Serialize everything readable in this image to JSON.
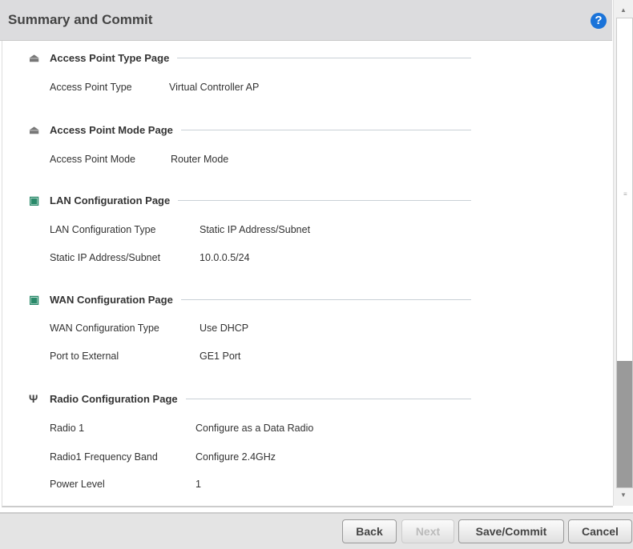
{
  "header": {
    "title": "Summary and Commit",
    "help_icon": "?"
  },
  "sections": [
    {
      "title": "Access Point Type Page",
      "icon": "access-point-icon",
      "rows": [
        {
          "k": "Access Point Type",
          "v": "Virtual Controller AP"
        }
      ]
    },
    {
      "title": "Access Point Mode Page",
      "icon": "access-point-icon",
      "rows": [
        {
          "k": "Access Point Mode",
          "v": "Router Mode"
        }
      ]
    },
    {
      "title": "LAN Configuration Page",
      "icon": "network-icon",
      "rows": [
        {
          "k": "LAN Configuration Type",
          "v": "Static IP Address/Subnet"
        },
        {
          "k": "Static IP Address/Subnet",
          "v": "10.0.0.5/24"
        }
      ]
    },
    {
      "title": "WAN Configuration Page",
      "icon": "network-icon",
      "rows": [
        {
          "k": "WAN Configuration Type",
          "v": "Use DHCP"
        },
        {
          "k": "Port to External",
          "v": "GE1 Port"
        }
      ]
    },
    {
      "title": "Radio Configuration Page",
      "icon": "antenna-icon",
      "rows": [
        {
          "k": "Radio 1",
          "v": "Configure as a Data Radio"
        },
        {
          "k": "Radio1 Frequency Band",
          "v": "Configure 2.4GHz"
        },
        {
          "k": "Power Level",
          "v": "1"
        }
      ]
    }
  ],
  "footer": {
    "back": "Back",
    "next": "Next",
    "save": "Save/Commit",
    "cancel": "Cancel"
  }
}
